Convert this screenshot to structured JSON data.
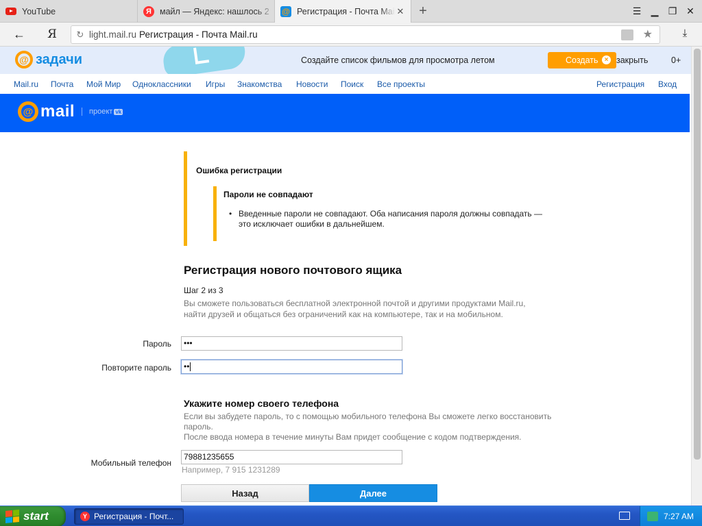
{
  "browser": {
    "tabs": [
      {
        "title": "YouTube",
        "icon": "youtube-icon"
      },
      {
        "title": "майл — Яндекс: нашлось 2",
        "icon": "yandex-icon"
      },
      {
        "title": "Регистрация - Почта Mail",
        "icon": "mail-icon"
      }
    ],
    "ya_label": "Я",
    "url_domain": "light.mail.ru",
    "url_title": "Регистрация - Почта Mail.ru"
  },
  "promo": {
    "logo_at": "@",
    "logo_name": "задачи",
    "text": "Создайте список фильмов для просмотра летом",
    "create_label": "Создать",
    "close_label": "закрыть",
    "age": "0+"
  },
  "portal_nav": {
    "items": [
      "Mail.ru",
      "Почта",
      "Мой Мир",
      "Одноклассники",
      "Игры",
      "Знакомства",
      "Новости",
      "Поиск",
      "Все проекты"
    ],
    "register": "Регистрация",
    "login": "Вход"
  },
  "header": {
    "logo_at": "@",
    "logo_text": "mail",
    "project_label": "проект",
    "vk_label": "vk"
  },
  "error": {
    "title": "Ошибка регистрации",
    "subtitle": "Пароли не совпадают",
    "message": "Введенные пароли не совпадают. Оба написания пароля должны совпадать — это исключает ошибки в дальнейшем."
  },
  "form": {
    "title": "Регистрация нового почтового ящика",
    "step": "Шаг 2 из 3",
    "description": "Вы сможете пользоваться бесплатной электронной почтой и другими продуктами Mail.ru, найти друзей и общаться без ограничений как на компьютере, так и на мобильном.",
    "password_label": "Пароль",
    "password_value": "•••",
    "repeat_label": "Повторите пароль",
    "repeat_value": "••",
    "phone_title": "Укажите номер своего телефона",
    "phone_desc_1": "Если вы забудете пароль, то с помощью мобильного телефона Вы сможете легко восстановить пароль.",
    "phone_desc_2": "После ввода номера в течение минуты Вам придет сообщение с кодом подтверждения.",
    "phone_label": "Мобильный телефон",
    "phone_value": "79881235655",
    "phone_hint": "Например, 7 915 1231289",
    "back_label": "Назад",
    "next_label": "Далее"
  },
  "taskbar": {
    "start_label": "start",
    "task_label": "Регистрация - Почт...",
    "clock": "7:27 AM"
  },
  "colors": {
    "brand_blue": "#005ff9",
    "accent_orange": "#ff9e00",
    "error_bar": "#f8b10a",
    "next_button": "#168de2"
  }
}
